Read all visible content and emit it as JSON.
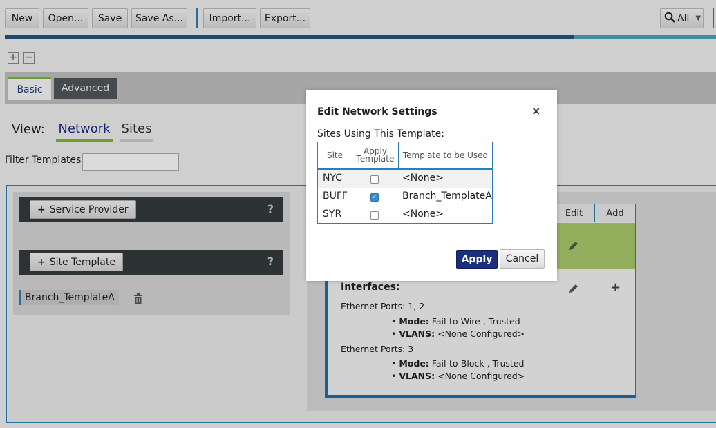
{
  "toolbar": {
    "new": "New",
    "open": "Open...",
    "save": "Save",
    "save_as": "Save As...",
    "import": "Import...",
    "export": "Export...",
    "search_filter": "All",
    "progress_fraction": 0.8
  },
  "tabs": {
    "basic": "Basic",
    "advanced": "Advanced"
  },
  "view": {
    "label": "View:",
    "network": "Network",
    "sites": "Sites"
  },
  "filter": {
    "label": "Filter Templates:",
    "value": ""
  },
  "left": {
    "service_provider": "Service Provider",
    "site_template": "Site Template",
    "help": "?",
    "template_item": "Branch_TemplateA"
  },
  "card": {
    "edit": "Edit",
    "add": "Add",
    "interfaces_title": "Interfaces:",
    "groups": [
      {
        "ports": "Ethernet Ports: 1, 2",
        "mode_label": "Mode:",
        "mode_value": "Fail-to-Wire , Trusted",
        "vlans_label": "VLANS:",
        "vlans_value": "<None Configured>"
      },
      {
        "ports": "Ethernet Ports: 3",
        "mode_label": "Mode:",
        "mode_value": "Fail-to-Block , Trusted",
        "vlans_label": "VLANS:",
        "vlans_value": "<None Configured>"
      }
    ]
  },
  "modal": {
    "title": "Edit Network Settings",
    "close": "×",
    "subtitle": "Sites Using This Template:",
    "headers": {
      "site": "Site",
      "apply": "Apply Template",
      "template": "Template to be Used"
    },
    "rows": [
      {
        "site": "NYC",
        "checked": false,
        "template": "<None>"
      },
      {
        "site": "BUFF",
        "checked": true,
        "template": "Branch_TemplateA"
      },
      {
        "site": "SYR",
        "checked": false,
        "template": "<None>"
      }
    ],
    "apply_button": "Apply",
    "cancel_button": "Cancel"
  }
}
